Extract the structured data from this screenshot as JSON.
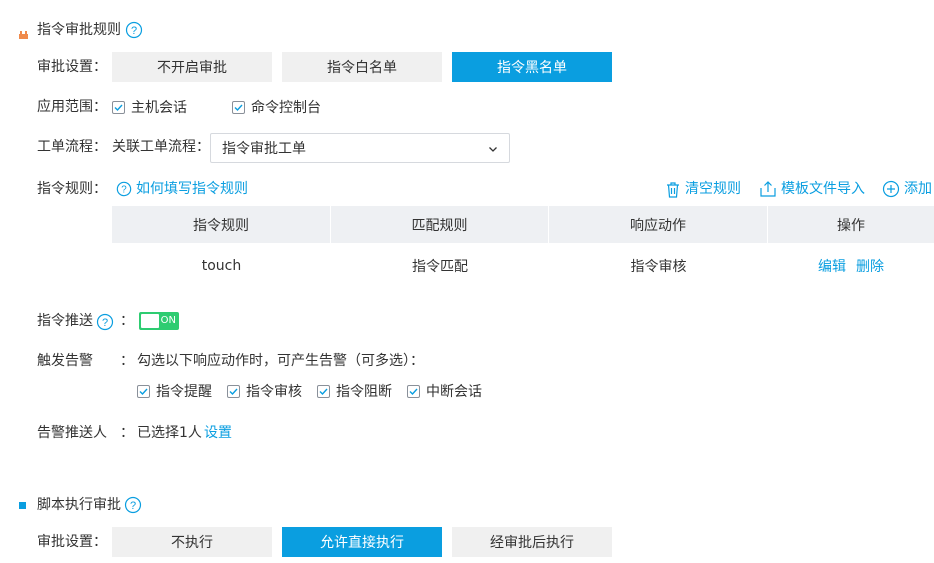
{
  "section1": {
    "title": "指令审批规则",
    "approval": {
      "label": "审批设置：",
      "options": [
        "不开启审批",
        "指令白名单",
        "指令黑名单"
      ],
      "active_index": 2
    },
    "scope": {
      "label": "应用范围：",
      "items": [
        {
          "label": "主机会话",
          "checked": true
        },
        {
          "label": "命令控制台",
          "checked": true
        }
      ]
    },
    "workflow": {
      "label": "工单流程：",
      "sub_label": "关联工单流程：",
      "selected": "指令审批工单"
    },
    "rules": {
      "label": "指令规则：",
      "help_link": "如何填写指令规则",
      "actions": {
        "clear": "清空规则",
        "import": "模板文件导入",
        "add": "添加"
      },
      "columns": [
        "指令规则",
        "匹配规则",
        "响应动作",
        "操作"
      ],
      "rows": [
        {
          "rule": "touch",
          "match": "指令匹配",
          "action": "指令审核",
          "edit": "编辑",
          "delete": "删除"
        }
      ]
    },
    "push": {
      "label": "指令推送",
      "colon": "：",
      "toggle_text": "ON",
      "enabled": true
    },
    "alert": {
      "label": "触发告警",
      "colon": "：",
      "description": "勾选以下响应动作时，可产生告警（可多选）：",
      "items": [
        {
          "label": "指令提醒",
          "checked": true
        },
        {
          "label": "指令审核",
          "checked": true
        },
        {
          "label": "指令阻断",
          "checked": true
        },
        {
          "label": "中断会话",
          "checked": true
        }
      ]
    },
    "recipient": {
      "label": "告警推送人",
      "colon": "：",
      "value": "已选择1人",
      "link": "设置"
    }
  },
  "section2": {
    "title": "脚本执行审批",
    "approval": {
      "label": "审批设置：",
      "options": [
        "不执行",
        "允许直接执行",
        "经审批后执行"
      ],
      "active_index": 1
    }
  },
  "colors": {
    "accent": "#0a9ee0",
    "marker1": "#f08a4b",
    "marker2": "#0a9ee0",
    "toggle_on": "#2ecc71"
  }
}
